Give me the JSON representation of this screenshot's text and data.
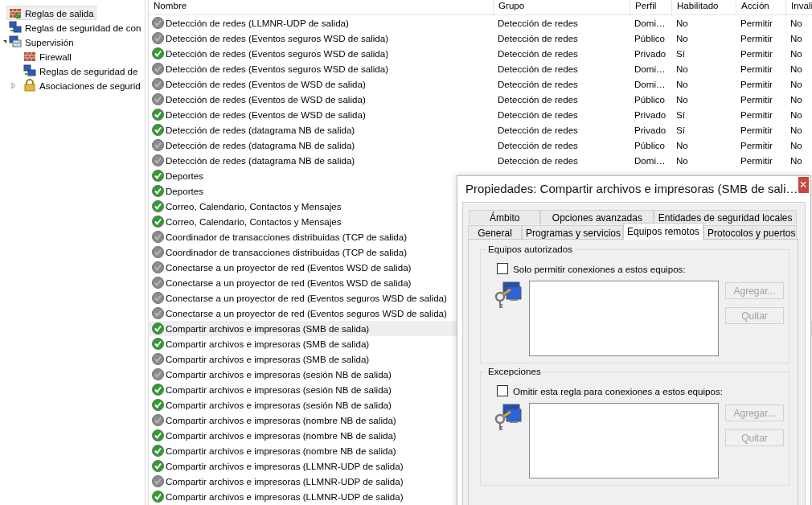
{
  "tree": [
    {
      "label": "Reglas de salida",
      "kind": "wall-arrow",
      "selected": true
    },
    {
      "label": "Reglas de seguridad de con",
      "kind": "computers",
      "selected": false
    },
    {
      "label": "Supervisión",
      "kind": "monitor",
      "selected": false,
      "expanded": true,
      "children": [
        {
          "label": "Firewall",
          "kind": "wall",
          "selected": false
        },
        {
          "label": "Reglas de seguridad de",
          "kind": "computers",
          "selected": false
        },
        {
          "label": "Asociaciones de segurid",
          "kind": "lock",
          "selected": false,
          "expanded": false
        }
      ]
    }
  ],
  "table": {
    "columns": [
      "Nombre",
      "Grupo",
      "Perfil",
      "Habilitado",
      "Acción",
      "Invali"
    ],
    "rows": [
      {
        "cells": [
          "Detección de redes (LLMNR-UDP de salida)",
          "Detección de redes",
          "Domi…",
          "No",
          "Permitir",
          "No"
        ],
        "enabled": false,
        "selected": false
      },
      {
        "cells": [
          "Detección de redes (Eventos seguros WSD de salida)",
          "Detección de redes",
          "Público",
          "No",
          "Permitir",
          "No"
        ],
        "enabled": false,
        "selected": false
      },
      {
        "cells": [
          "Detección de redes (Eventos seguros WSD de salida)",
          "Detección de redes",
          "Privado",
          "Sí",
          "Permitir",
          "No"
        ],
        "enabled": true,
        "selected": false
      },
      {
        "cells": [
          "Detección de redes (Eventos seguros WSD de salida)",
          "Detección de redes",
          "Domi…",
          "No",
          "Permitir",
          "No"
        ],
        "enabled": false,
        "selected": false
      },
      {
        "cells": [
          "Detección de redes (Eventos de WSD de salida)",
          "Detección de redes",
          "Domi…",
          "No",
          "Permitir",
          "No"
        ],
        "enabled": false,
        "selected": false
      },
      {
        "cells": [
          "Detección de redes (Eventos de WSD de salida)",
          "Detección de redes",
          "Público",
          "No",
          "Permitir",
          "No"
        ],
        "enabled": false,
        "selected": false
      },
      {
        "cells": [
          "Detección de redes (Eventos de WSD de salida)",
          "Detección de redes",
          "Privado",
          "Sí",
          "Permitir",
          "No"
        ],
        "enabled": true,
        "selected": false
      },
      {
        "cells": [
          "Detección de redes (datagrama NB de salida)",
          "Detección de redes",
          "Privado",
          "Sí",
          "Permitir",
          "No"
        ],
        "enabled": true,
        "selected": false
      },
      {
        "cells": [
          "Detección de redes (datagrama NB de salida)",
          "Detección de redes",
          "Público",
          "No",
          "Permitir",
          "No"
        ],
        "enabled": false,
        "selected": false
      },
      {
        "cells": [
          "Detección de redes (datagrama NB de salida)",
          "Detección de redes",
          "Domi…",
          "No",
          "Permitir",
          "No"
        ],
        "enabled": false,
        "selected": false
      },
      {
        "cells": [
          "Deportes"
        ],
        "enabled": true,
        "selected": false
      },
      {
        "cells": [
          "Deportes"
        ],
        "enabled": true,
        "selected": false
      },
      {
        "cells": [
          "Correo, Calendario, Contactos y Mensajes"
        ],
        "enabled": true,
        "selected": false
      },
      {
        "cells": [
          "Correo, Calendario, Contactos y Mensajes"
        ],
        "enabled": true,
        "selected": false
      },
      {
        "cells": [
          "Coordinador de transacciones distribuidas (TCP de salida)"
        ],
        "enabled": false,
        "selected": false
      },
      {
        "cells": [
          "Coordinador de transacciones distribuidas (TCP de salida)"
        ],
        "enabled": false,
        "selected": false
      },
      {
        "cells": [
          "Conectarse a un proyector de red (Eventos WSD de salida)"
        ],
        "enabled": false,
        "selected": false
      },
      {
        "cells": [
          "Conectarse a un proyector de red (Eventos WSD de salida)"
        ],
        "enabled": false,
        "selected": false
      },
      {
        "cells": [
          "Conectarse a un proyector de red (Eventos seguros WSD de salida)"
        ],
        "enabled": false,
        "selected": false
      },
      {
        "cells": [
          "Conectarse a un proyector de red (Eventos seguros WSD de salida)"
        ],
        "enabled": false,
        "selected": false
      },
      {
        "cells": [
          "Compartir archivos e impresoras (SMB de salida)"
        ],
        "enabled": true,
        "selected": true
      },
      {
        "cells": [
          "Compartir archivos e impresoras (SMB de salida)"
        ],
        "enabled": true,
        "selected": false
      },
      {
        "cells": [
          "Compartir archivos e impresoras (SMB de salida)"
        ],
        "enabled": false,
        "selected": false
      },
      {
        "cells": [
          "Compartir archivos e impresoras (sesión NB de salida)"
        ],
        "enabled": false,
        "selected": false
      },
      {
        "cells": [
          "Compartir archivos e impresoras (sesión NB de salida)"
        ],
        "enabled": true,
        "selected": false
      },
      {
        "cells": [
          "Compartir archivos e impresoras (sesión NB de salida)"
        ],
        "enabled": true,
        "selected": false
      },
      {
        "cells": [
          "Compartir archivos e impresoras (nombre NB de salida)"
        ],
        "enabled": false,
        "selected": false
      },
      {
        "cells": [
          "Compartir archivos e impresoras (nombre NB de salida)"
        ],
        "enabled": true,
        "selected": false
      },
      {
        "cells": [
          "Compartir archivos e impresoras (nombre NB de salida)"
        ],
        "enabled": true,
        "selected": false
      },
      {
        "cells": [
          "Compartir archivos e impresoras (LLMNR-UDP de salida)"
        ],
        "enabled": true,
        "selected": false
      },
      {
        "cells": [
          "Compartir archivos e impresoras (LLMNR-UDP de salida)"
        ],
        "enabled": false,
        "selected": false
      },
      {
        "cells": [
          "Compartir archivos e impresoras (LLMNR-UDP de salida)"
        ],
        "enabled": true,
        "selected": false
      }
    ]
  },
  "dialog": {
    "title": "Propiedades: Compartir archivos e impresoras (SMB de sali…",
    "close": "×",
    "tab_rows": [
      [
        {
          "label": "Ámbito",
          "selected": false
        },
        {
          "label": "Opciones avanzadas",
          "selected": false
        },
        {
          "label": "Entidades de seguridad locales",
          "selected": false
        }
      ],
      [
        {
          "label": "General",
          "selected": false
        },
        {
          "label": "Programas y servicios",
          "selected": false
        },
        {
          "label": "Equipos remotos",
          "selected": true
        },
        {
          "label": "Protocolos y puertos",
          "selected": false
        }
      ]
    ],
    "groups": [
      {
        "title": "Equipos autorizados",
        "checkbox": "Solo permitir conexiones a estos equipos:",
        "checked": false,
        "buttons": [
          {
            "label": "Agregar...",
            "disabled": true
          },
          {
            "label": "Quitar",
            "disabled": true
          }
        ]
      },
      {
        "title": "Excepciones",
        "checkbox": "Omitir esta regla para conexiones a estos equipos:",
        "checked": false,
        "buttons": [
          {
            "label": "Agregar...",
            "disabled": true
          },
          {
            "label": "Quitar",
            "disabled": true
          }
        ]
      }
    ]
  }
}
